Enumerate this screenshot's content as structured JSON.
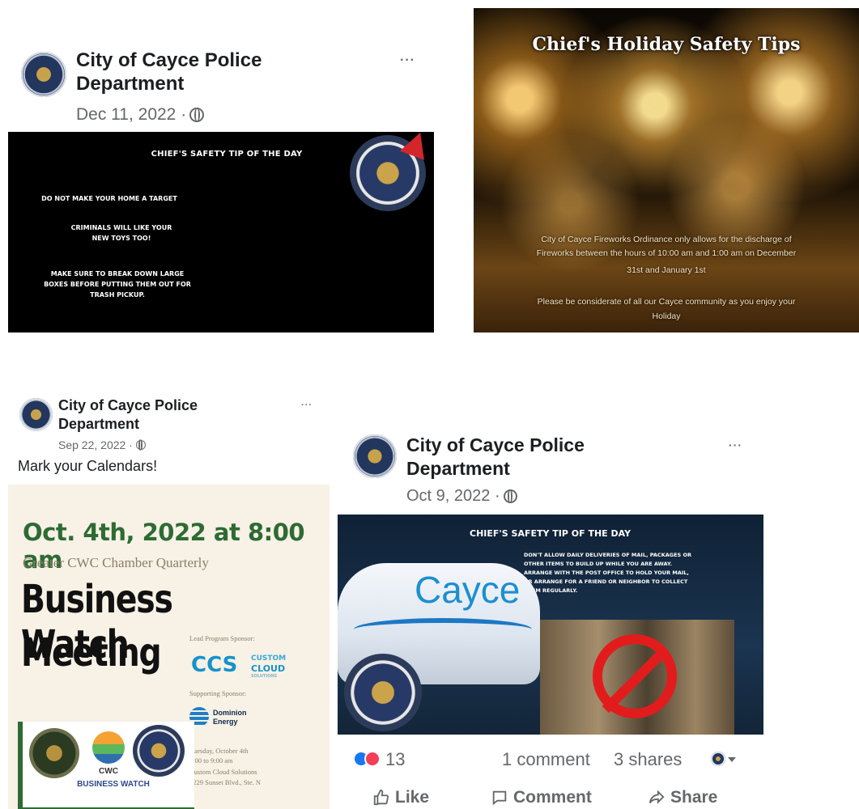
{
  "post1": {
    "author": "City of Cayce Police Department",
    "date": "Dec 11, 2022 ·",
    "more": "···",
    "image": {
      "title": "CHIEF'S SAFETY TIP OF THE DAY",
      "line1": "DO NOT MAKE YOUR HOME A TARGET",
      "line2": "CRIMINALS WILL LIKE YOUR",
      "line3": "NEW TOYS TOO!",
      "line4": "MAKE SURE TO BREAK DOWN LARGE",
      "line5": "BOXES BEFORE PUTTING THEM OUT FOR",
      "line6": "TRASH PICKUP."
    }
  },
  "post2": {
    "image": {
      "title": "Chief's Holiday Safety Tips",
      "line1": "City of Cayce Fireworks Ordinance only allows for the discharge of",
      "line2": "Fireworks between the hours of 10:00 am and 1:00 am on December",
      "line3": "31st and January 1st",
      "line4": "Please be considerate of all our Cayce community as you enjoy your",
      "line5": "Holiday"
    }
  },
  "post3": {
    "author_line1": "City of Cayce Police",
    "author_line2": "Department",
    "date": "Sep 22, 2022 ·",
    "more": "···",
    "caption": "Mark your Calendars!",
    "flyer": {
      "date": "Oct. 4th, 2022 at 8:00 am",
      "subtitle": "Greater CWC Chamber Quarterly",
      "big1": "Business Watch",
      "big2": "Meeting",
      "lead_sponsor": "Lead Program Sponsor:",
      "ccs": "CCS",
      "custom": "CUSTOM",
      "cloud": "CLOUD",
      "solutions": "SOLUTIONS",
      "supporting": "Supporting Sponsor:",
      "dominion1": "Dominion",
      "dominion2": "Energy",
      "details1": "Tuesday, October 4th",
      "details2": "8:00 to 9:00 am",
      "details3": "Custom Cloud Solutions",
      "details4": "3229 Sunset Blvd., Ste. N",
      "cwc": "CWC",
      "business_watch": "BUSINESS WATCH"
    }
  },
  "post4": {
    "author_line1": "City of Cayce Police",
    "author_line2": "Department",
    "date": "Oct 9, 2022 ·",
    "more": "···",
    "image": {
      "title": "CHIEF'S SAFETY TIP OF THE DAY",
      "text1": "DON'T ALLOW DAILY DELIVERIES OF MAIL, PACKAGES OR",
      "text2": "OTHER ITEMS TO BUILD UP WHILE YOU ARE AWAY.",
      "text3": "ARRANGE WITH THE POST OFFICE TO HOLD YOUR MAIL,",
      "text4": "OR ARRANGE FOR A FRIEND OR NEIGHBOR TO COLLECT",
      "text5": "THEM REGULARLY.",
      "tower_word": "Cayce"
    },
    "reaction_count": "13",
    "comments": "1 comment",
    "shares": "3 shares",
    "like": "Like",
    "comment": "Comment",
    "share": "Share",
    "colors": {
      "like_blue": "#1877f2",
      "love_red": "#f33e58"
    }
  }
}
